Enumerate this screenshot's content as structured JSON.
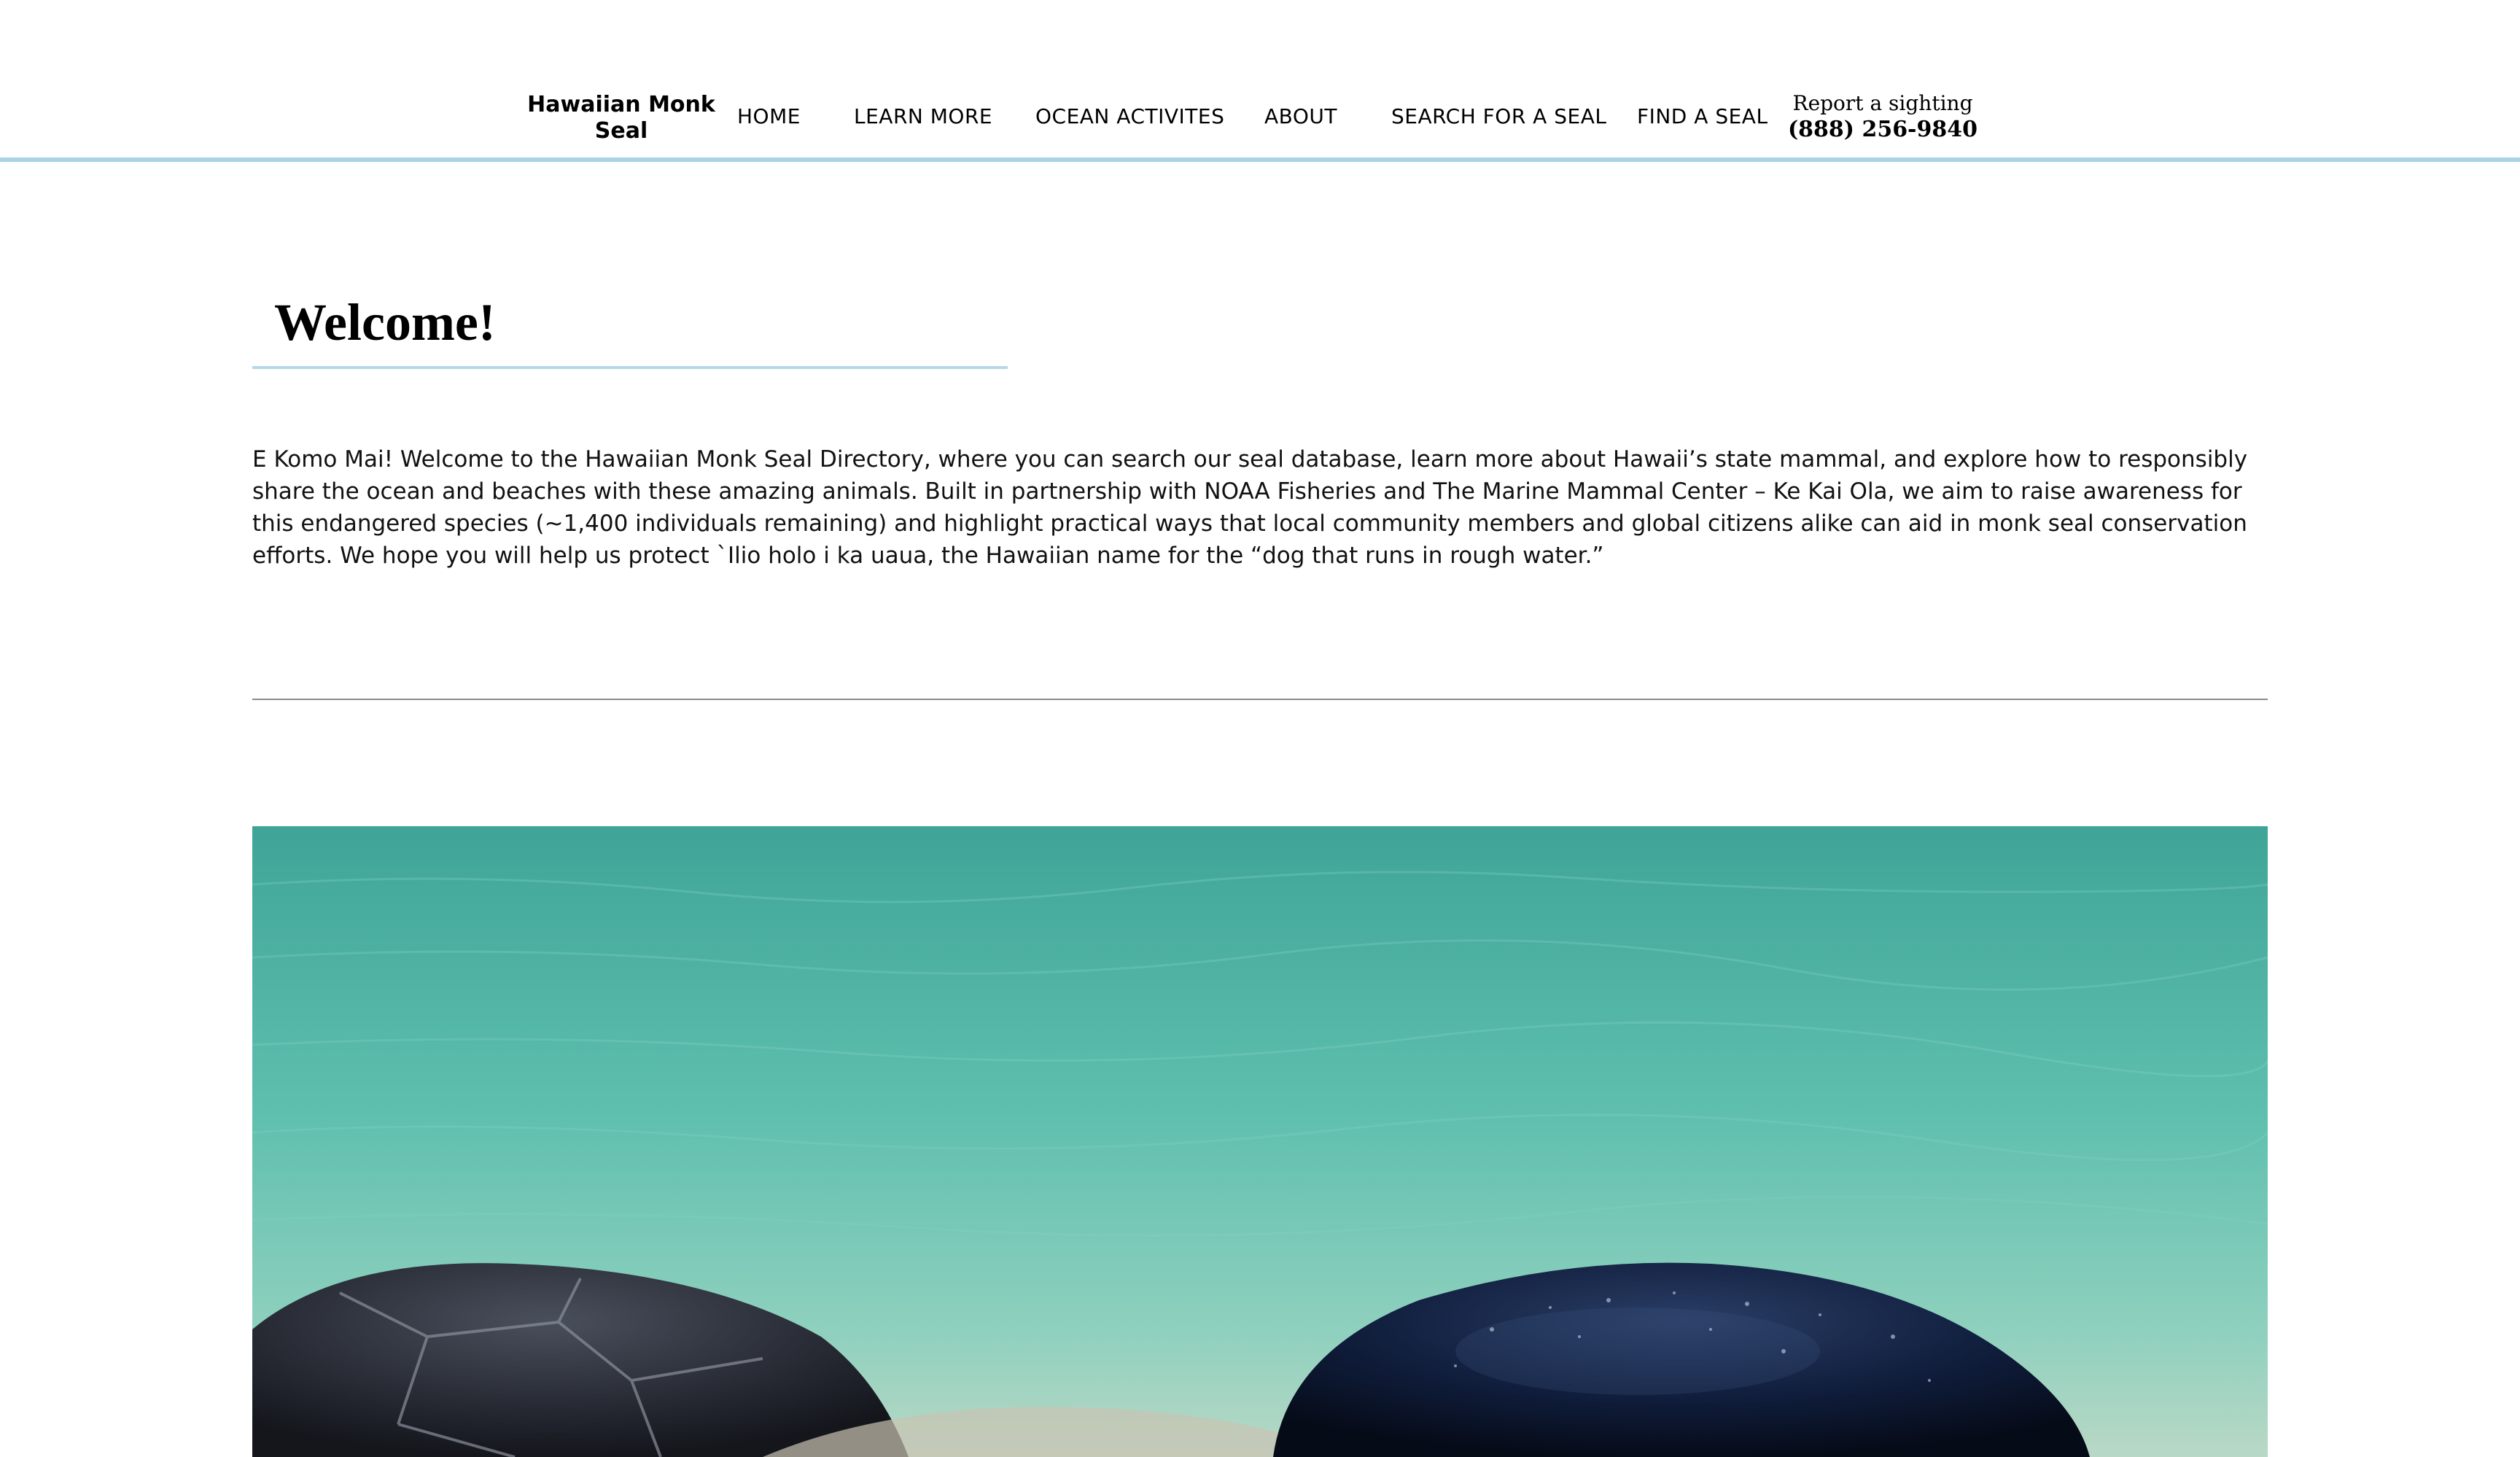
{
  "header": {
    "brand": "Hawaiian Monk Seal",
    "nav": [
      "HOME",
      "LEARN MORE",
      "OCEAN ACTIVITES",
      "ABOUT",
      "SEARCH FOR A SEAL",
      "FIND A SEAL"
    ],
    "report_label": "Report a sighting",
    "report_phone": "(888) 256-9840"
  },
  "main": {
    "title": "Welcome!",
    "intro": "E Komo Mai! Welcome to the Hawaiian Monk Seal Directory, where you can search our seal database, learn more about Hawaii’s state mammal, and explore how to responsibly share the ocean and beaches with these amazing animals. Built in partnership with NOAA Fisheries and The Marine Mammal Center – Ke Kai Ola, we aim to raise awareness for this endangered species (~1,400 individuals remaining) and highlight practical ways that local community members and global citizens alike can aid in monk seal conservation efforts. We hope you will help us protect `Ilio holo i ka uaua, the Hawaiian name for the “dog that runs in rough water.”"
  },
  "colors": {
    "header_border": "#a9d3e3",
    "title_rule": "#b6d7e7",
    "ocean": "#5fb8ad",
    "seal": "#0e1a33",
    "turtle_shell": "#2b2f3a"
  },
  "icons": {
    "hero": "monk-seal-and-sea-turtle-photo"
  }
}
